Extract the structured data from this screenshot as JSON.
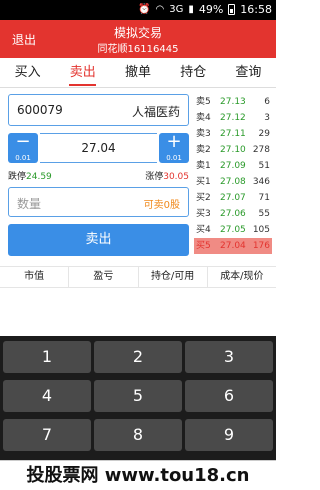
{
  "status_bar": {
    "network": "3G",
    "battery": "49%",
    "time": "16:58"
  },
  "header": {
    "exit_label": "退出",
    "title": "模拟交易",
    "subtitle": "同花顺16116445"
  },
  "tabs": [
    {
      "label": "买入"
    },
    {
      "label": "卖出",
      "active": true
    },
    {
      "label": "撤单"
    },
    {
      "label": "持仓"
    },
    {
      "label": "查询"
    }
  ],
  "form": {
    "stock_code": "600079",
    "stock_name": "人福医药",
    "price": "27.04",
    "step_minus": "0.01",
    "step_plus": "0.01",
    "limit_down_label": "跌停",
    "limit_down_value": "24.59",
    "limit_up_label": "涨停",
    "limit_up_value": "30.05",
    "quantity_placeholder": "数量",
    "available_text": "可卖0股",
    "sell_button": "卖出"
  },
  "order_book": [
    {
      "label": "卖5",
      "price": "27.13",
      "volume": "6"
    },
    {
      "label": "卖4",
      "price": "27.12",
      "volume": "3"
    },
    {
      "label": "卖3",
      "price": "27.11",
      "volume": "29"
    },
    {
      "label": "卖2",
      "price": "27.10",
      "volume": "278"
    },
    {
      "label": "卖1",
      "price": "27.09",
      "volume": "51"
    },
    {
      "label": "买1",
      "price": "27.08",
      "volume": "346"
    },
    {
      "label": "买2",
      "price": "27.07",
      "volume": "71"
    },
    {
      "label": "买3",
      "price": "27.06",
      "volume": "55"
    },
    {
      "label": "买4",
      "price": "27.05",
      "volume": "105"
    },
    {
      "label": "买5",
      "price": "27.04",
      "volume": "176",
      "highlight": true
    }
  ],
  "table_header": [
    "市值",
    "盈亏",
    "持仓/可用",
    "成本/现价"
  ],
  "keypad": [
    "1",
    "2",
    "3",
    "4",
    "5",
    "6",
    "7",
    "8",
    "9"
  ],
  "watermark": "投股票网 www.tou18.cn",
  "colors": {
    "header": "#e3342f",
    "accent": "#3a8ee6",
    "price_green": "#2a9a2a",
    "highlight_row": "#f08b84"
  }
}
